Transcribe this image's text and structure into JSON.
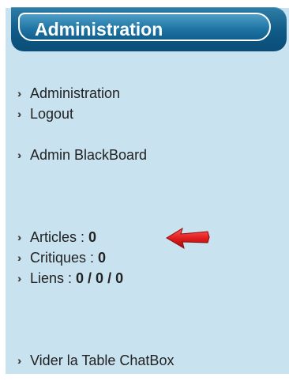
{
  "header": {
    "title": "Administration"
  },
  "menu": {
    "group1": [
      {
        "label": "Administration"
      },
      {
        "label": "Logout"
      }
    ],
    "group2": [
      {
        "label": "Admin BlackBoard"
      }
    ],
    "stats": [
      {
        "label": "Articles : ",
        "value": "0"
      },
      {
        "label": "Critiques : ",
        "value": "0"
      },
      {
        "label": "Liens : ",
        "value": "0 / 0 / 0"
      }
    ],
    "group4": [
      {
        "label": "Vider la Table ChatBox"
      }
    ]
  },
  "icons": {
    "bullet": "double-chevron-right-icon",
    "pointer": "red-arrow-left-icon"
  },
  "colors": {
    "panel_bg": "#c8e2ef",
    "header_bg": "#0f5a86",
    "arrow": "#d11a1a"
  }
}
